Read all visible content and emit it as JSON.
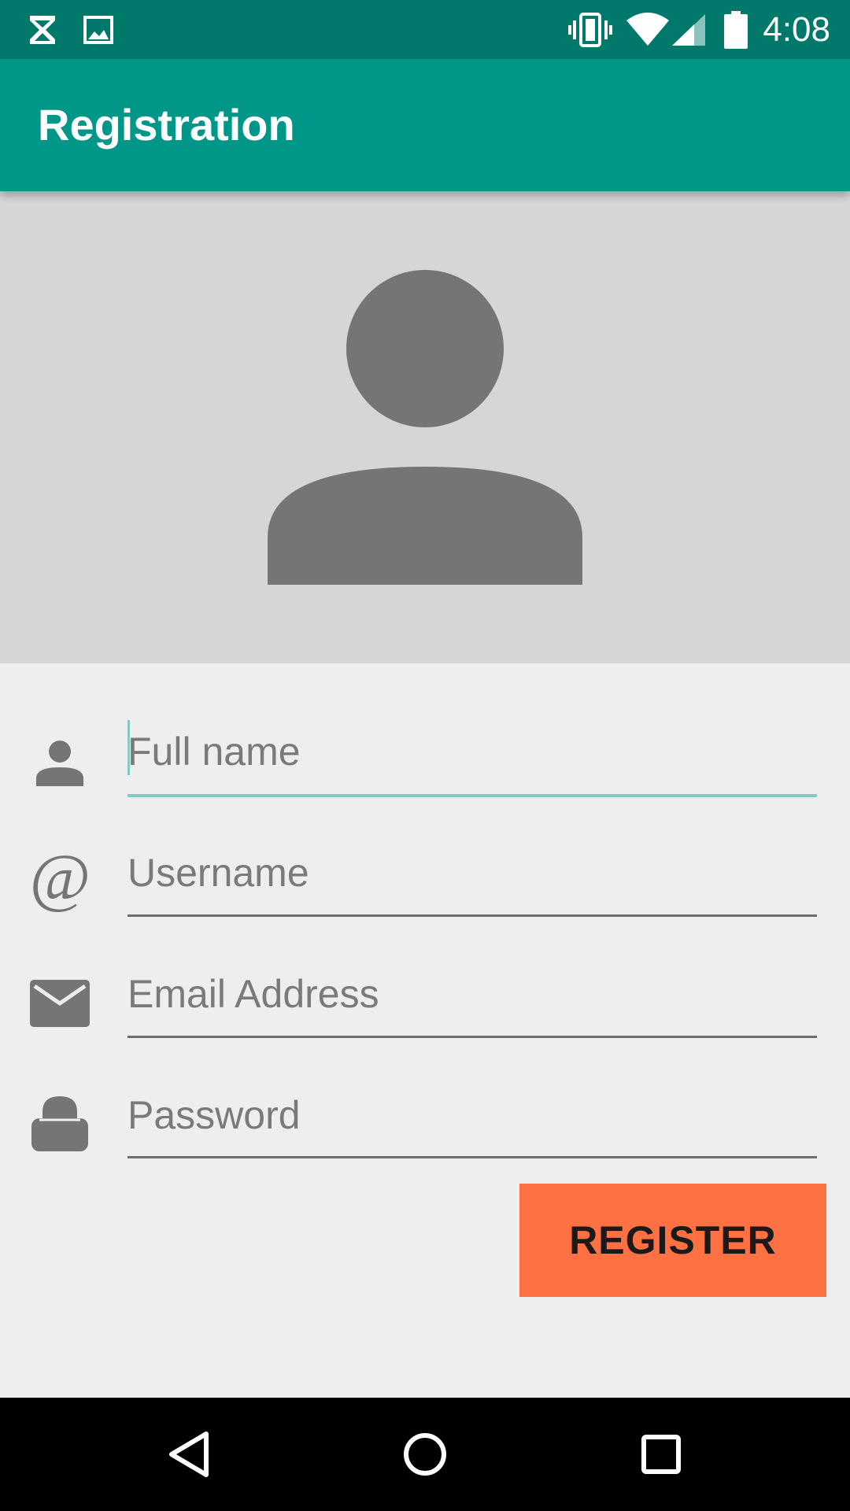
{
  "status_bar": {
    "time": "4:08",
    "left_icons": [
      "hourglass-icon",
      "image-icon"
    ],
    "right_icons": [
      "vibrate-icon",
      "wifi-icon",
      "cell-signal-icon",
      "battery-icon"
    ]
  },
  "app_bar": {
    "title": "Registration"
  },
  "form": {
    "full_name": {
      "placeholder": "Full name",
      "value": "",
      "icon": "person-icon"
    },
    "username": {
      "placeholder": "Username",
      "value": "",
      "icon": "at-icon"
    },
    "email": {
      "placeholder": "Email Address",
      "value": "",
      "icon": "mail-icon"
    },
    "password": {
      "placeholder": "Password",
      "value": "",
      "icon": "lock-icon"
    },
    "register_label": "REGISTER"
  },
  "colors": {
    "status_bar": "#00796b",
    "app_bar": "#009688",
    "accent": "#80cbc4",
    "register_button": "#ff7043",
    "avatar_bg": "#d6d6d6",
    "avatar_fg": "#757575"
  },
  "nav_bar": {
    "icons": [
      "back-icon",
      "home-icon",
      "recents-icon"
    ]
  }
}
